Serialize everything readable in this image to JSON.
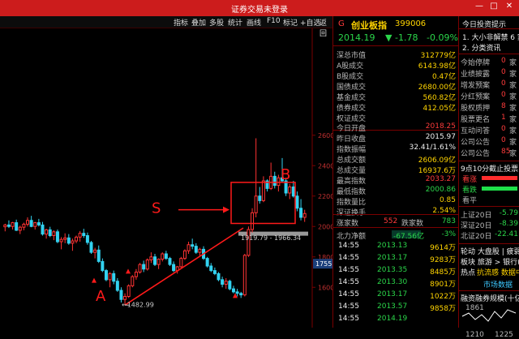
{
  "window": {
    "title": "证券交易未登录"
  },
  "toolbar": [
    "指标",
    "叠加",
    "多股",
    "统计",
    "画线",
    "F10",
    "标记",
    "+自选",
    "返回"
  ],
  "chart": {
    "y_ticks": [
      "2600",
      "2400",
      "2200",
      "2000",
      "1800",
      "1600"
    ],
    "price_marker": "1755.2",
    "low_label": "1482.99",
    "range_label": "1919.79 - 1966.34",
    "annotations": {
      "a": "A",
      "b": "B",
      "s": "S"
    },
    "colors": {
      "up": "#ff3333",
      "down": "#32d2f0",
      "annot": "#ff1a1a"
    },
    "candles": [
      [
        1998,
        2018,
        1968,
        2010
      ],
      [
        2010,
        2040,
        1990,
        2000
      ],
      [
        2000,
        2030,
        1980,
        2025
      ],
      [
        2025,
        2045,
        1970,
        1975
      ],
      [
        1975,
        2005,
        1950,
        1995
      ],
      [
        1995,
        2025,
        1975,
        2015
      ],
      [
        2015,
        2060,
        2000,
        2040
      ],
      [
        2040,
        2070,
        1995,
        2000
      ],
      [
        2000,
        2030,
        1980,
        2025
      ],
      [
        2025,
        2050,
        2000,
        2010
      ],
      [
        2010,
        2030,
        1940,
        1950
      ],
      [
        1950,
        1985,
        1920,
        1978
      ],
      [
        1978,
        1998,
        1930,
        1940
      ],
      [
        1940,
        1975,
        1910,
        1965
      ],
      [
        1965,
        1980,
        1890,
        1900
      ],
      [
        1900,
        1930,
        1850,
        1915
      ],
      [
        1915,
        1955,
        1890,
        1925
      ],
      [
        1925,
        1950,
        1880,
        1890
      ],
      [
        1890,
        1920,
        1840,
        1905
      ],
      [
        1905,
        1940,
        1890,
        1930
      ],
      [
        1930,
        1970,
        1900,
        1955
      ],
      [
        1955,
        1985,
        1925,
        1940
      ],
      [
        1940,
        1960,
        1880,
        1895
      ],
      [
        1895,
        1905,
        1820,
        1830
      ],
      [
        1830,
        1860,
        1790,
        1845
      ],
      [
        1845,
        1875,
        1760,
        1770
      ],
      [
        1770,
        1790,
        1700,
        1710
      ],
      [
        1710,
        1720,
        1640,
        1650
      ],
      [
        1650,
        1700,
        1600,
        1690
      ],
      [
        1690,
        1710,
        1620,
        1640
      ],
      [
        1640,
        1660,
        1570,
        1580
      ],
      [
        1580,
        1600,
        1500,
        1520
      ],
      [
        1520,
        1560,
        1483,
        1540
      ],
      [
        1540,
        1620,
        1530,
        1610
      ],
      [
        1610,
        1680,
        1600,
        1670
      ],
      [
        1670,
        1720,
        1650,
        1700
      ],
      [
        1700,
        1760,
        1690,
        1750
      ],
      [
        1750,
        1775,
        1700,
        1720
      ],
      [
        1720,
        1790,
        1710,
        1780
      ],
      [
        1780,
        1830,
        1760,
        1800
      ],
      [
        1800,
        1820,
        1740,
        1750
      ],
      [
        1750,
        1790,
        1720,
        1785
      ],
      [
        1785,
        1830,
        1770,
        1820
      ],
      [
        1820,
        1840,
        1780,
        1790
      ],
      [
        1790,
        1800,
        1740,
        1750
      ],
      [
        1750,
        1770,
        1700,
        1710
      ],
      [
        1710,
        1740,
        1690,
        1735
      ],
      [
        1735,
        1800,
        1730,
        1790
      ],
      [
        1790,
        1850,
        1780,
        1840
      ],
      [
        1840,
        1900,
        1820,
        1880
      ],
      [
        1880,
        1920,
        1850,
        1870
      ],
      [
        1870,
        1890,
        1820,
        1830
      ],
      [
        1830,
        1860,
        1800,
        1850
      ],
      [
        1850,
        1870,
        1780,
        1790
      ],
      [
        1790,
        1800,
        1730,
        1740
      ],
      [
        1740,
        1760,
        1700,
        1710
      ],
      [
        1710,
        1730,
        1680,
        1690
      ],
      [
        1690,
        1700,
        1640,
        1650
      ],
      [
        1650,
        1670,
        1600,
        1620
      ],
      [
        1620,
        1660,
        1590,
        1640
      ],
      [
        1640,
        1650,
        1580,
        1590
      ],
      [
        1590,
        1610,
        1560,
        1570
      ],
      [
        1570,
        1590,
        1540,
        1560
      ],
      [
        1560,
        1570,
        1530,
        1550
      ],
      [
        1550,
        1820,
        1540,
        1810
      ],
      [
        1810,
        2000,
        1800,
        1980
      ],
      [
        1980,
        2120,
        1960,
        2090
      ],
      [
        2090,
        2580,
        2060,
        2200
      ],
      [
        2200,
        2260,
        2150,
        2170
      ],
      [
        2170,
        2330,
        2160,
        2300
      ],
      [
        2300,
        2310,
        2230,
        2250
      ],
      [
        2250,
        2420,
        2240,
        2330
      ],
      [
        2330,
        2360,
        2250,
        2270
      ],
      [
        2270,
        2340,
        2230,
        2320
      ],
      [
        2320,
        2450,
        2290,
        2300
      ],
      [
        2300,
        2320,
        2200,
        2220
      ],
      [
        2220,
        2280,
        2180,
        2260
      ],
      [
        2260,
        2300,
        2190,
        2200
      ],
      [
        2200,
        2230,
        2100,
        2120
      ],
      [
        2120,
        2180,
        2040,
        2060
      ],
      [
        2060,
        2110,
        2030,
        2085
      ]
    ]
  },
  "quote": {
    "code": "G",
    "name": "创业板指",
    "number": "399006",
    "price": "2014.19",
    "arrow": "▼",
    "change": "-1.78",
    "pct": "-0.09%"
  },
  "stats1": [
    {
      "l": "深总市值",
      "v": "312779亿"
    },
    {
      "l": "A股成交",
      "v": "6143.98亿"
    },
    {
      "l": "B股成交",
      "v": "0.47亿"
    },
    {
      "l": "国债成交",
      "v": "2680.00亿"
    },
    {
      "l": "基金成交",
      "v": "560.82亿"
    },
    {
      "l": "债券成交",
      "v": "412.05亿"
    },
    {
      "l": "权证成交",
      "v": ""
    }
  ],
  "stats2": [
    {
      "l": "今日开盘",
      "v": "2018.25",
      "c": "red"
    },
    {
      "l": "昨日收盘",
      "v": "2015.97",
      "c": "wht"
    },
    {
      "l": "指数振幅",
      "v": "32.41/1.61%",
      "c": "wht"
    },
    {
      "l": "总成交额",
      "v": "2606.09亿",
      "c": "yel"
    },
    {
      "l": "总成交量",
      "v": "16937.6万",
      "c": "yel"
    },
    {
      "l": "最高指数",
      "v": "2033.27",
      "c": "red"
    },
    {
      "l": "最低指数",
      "v": "2000.86",
      "c": "grn"
    },
    {
      "l": "指数量比",
      "v": "0.85",
      "c": "yel"
    },
    {
      "l": "深证换手",
      "v": "2.54%",
      "c": "yel"
    }
  ],
  "updown": {
    "l1": "涨家数",
    "v1": "552",
    "l2": "跌家数",
    "v2": "783"
  },
  "flow": {
    "label": "北力净额",
    "v1": "-67.56亿",
    "v2": "-3%"
  },
  "ticks": [
    {
      "t": "14:55",
      "p": "2013.13",
      "v": "9614万"
    },
    {
      "t": "14:55",
      "p": "2013.17",
      "v": "9283万"
    },
    {
      "t": "14:55",
      "p": "2013.35",
      "v": "8485万"
    },
    {
      "t": "14:55",
      "p": "2013.30",
      "v": "8901万"
    },
    {
      "t": "14:55",
      "p": "2013.17",
      "v": "1022万"
    },
    {
      "t": "14:55",
      "p": "2013.57",
      "v": "9858万"
    },
    {
      "t": "14:55",
      "p": "2014.19",
      "v": ""
    }
  ],
  "fp": {
    "header": "今日投资提示",
    "items": [
      "1. 大小非解禁 6 家",
      "2. 分类资讯"
    ],
    "rows": [
      {
        "l": "今始停牌",
        "v": "0",
        "u": "家"
      },
      {
        "l": "业绩披露",
        "v": "0",
        "u": "家"
      },
      {
        "l": "增发预案",
        "v": "0",
        "u": "家"
      },
      {
        "l": "分红预案",
        "v": "0",
        "u": "家"
      },
      {
        "l": "股权质押",
        "v": "8",
        "u": "家"
      },
      {
        "l": "股票更名",
        "v": "1",
        "u": "家"
      },
      {
        "l": "互动问答",
        "v": "0",
        "u": "家"
      },
      {
        "l": "公司公告",
        "v": "0",
        "u": "家"
      },
      {
        "l": "公司公告",
        "v": "85",
        "u": "家"
      }
    ],
    "sentiment_title": "9点10分截止投票",
    "s1": "看涨",
    "s2": "看跌",
    "s3": "看平",
    "idx": [
      {
        "l": "上证20日",
        "v": "-5.79"
      },
      {
        "l": "深证20日",
        "v": "-8.39"
      },
      {
        "l": "北证20日",
        "v": "-22.41"
      }
    ],
    "lunhui": "轮动 大盘股 | 疲弱",
    "bankuai": "板块 旅游 > 银行(",
    "redian": "热点",
    "redian_v": "抗流感 数据中",
    "market": "市场数据",
    "rzrq": "融资融券规模(十亿)",
    "rz_val": "1861",
    "xaxis": [
      "1210",
      "1225"
    ]
  }
}
